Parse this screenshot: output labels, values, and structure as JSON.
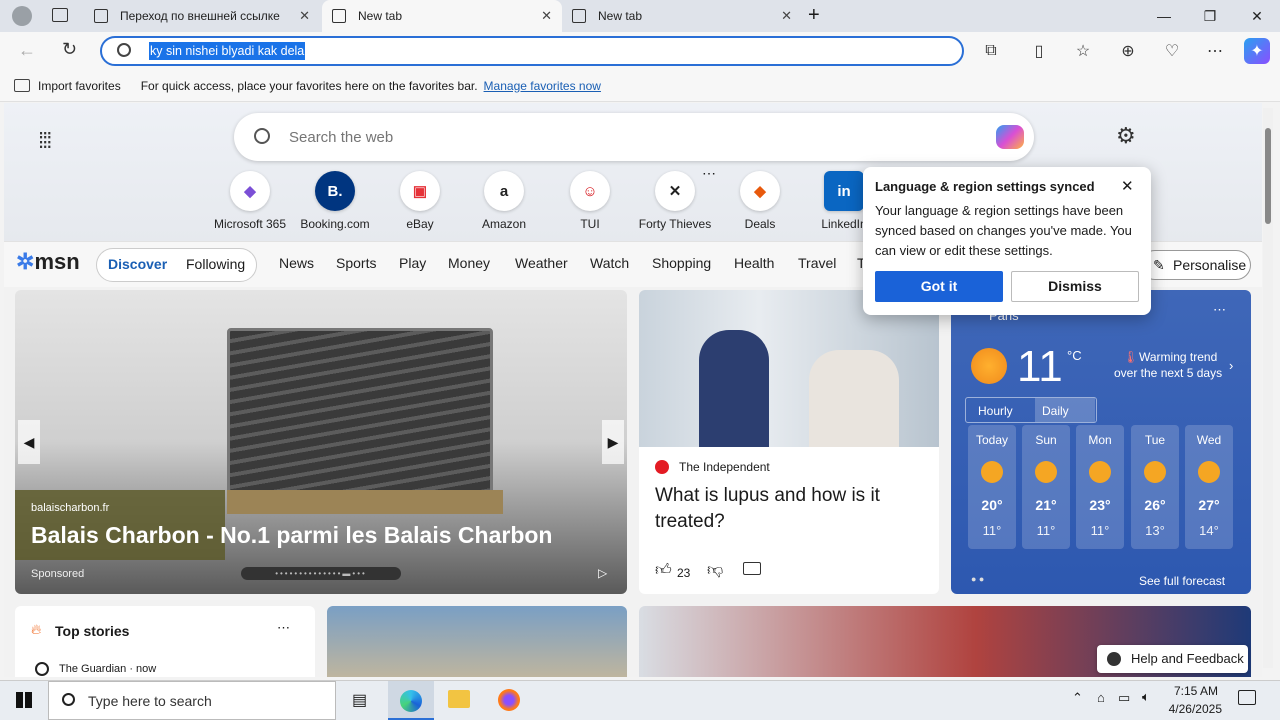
{
  "tabs": [
    {
      "label": "Переход по внешней ссылке"
    },
    {
      "label": "New tab"
    },
    {
      "label": "New tab"
    }
  ],
  "address": {
    "value": "ky sin nishei blyadi kak dela"
  },
  "favbar": {
    "import": "Import favorites",
    "hint": "For quick access, place your favorites here on the favorites bar.",
    "manage": "Manage favorites now"
  },
  "search": {
    "placeholder": "Search the web"
  },
  "quicklinks": [
    {
      "label": "Microsoft 365",
      "icon": "office-icon"
    },
    {
      "label": "Booking.com",
      "icon": "B."
    },
    {
      "label": "eBay",
      "icon": "bag"
    },
    {
      "label": "Amazon",
      "icon": "a"
    },
    {
      "label": "TUI",
      "icon": "tui"
    },
    {
      "label": "Forty Thieves",
      "icon": "swords"
    },
    {
      "label": "Deals",
      "icon": "tag"
    },
    {
      "label": "LinkedIn",
      "icon": "in"
    }
  ],
  "nav": {
    "brand": "msn",
    "discover": "Discover",
    "following": "Following",
    "items": [
      "News",
      "Sports",
      "Play",
      "Money",
      "Weather",
      "Watch",
      "Shopping",
      "Health",
      "Travel",
      "T"
    ],
    "personalise": "Personalise"
  },
  "hero": {
    "source": "balaischarbon.fr",
    "title": "Balais Charbon - No.1 parmi les Balais Charbon",
    "sponsored": "Sponsored"
  },
  "story": {
    "source": "The Independent",
    "title": "What is lupus and how is it treated?",
    "likes": "23"
  },
  "weather": {
    "location": "Paris",
    "temp": "11",
    "unit": "°C",
    "trend": "Warming trend",
    "trend2": "over the next 5 days",
    "tab_hourly": "Hourly",
    "tab_daily": "Daily",
    "days": [
      {
        "d": "Today",
        "h": "20°",
        "l": "11°"
      },
      {
        "d": "Sun",
        "h": "21°",
        "l": "11°"
      },
      {
        "d": "Mon",
        "h": "23°",
        "l": "11°"
      },
      {
        "d": "Tue",
        "h": "26°",
        "l": "13°"
      },
      {
        "d": "Wed",
        "h": "27°",
        "l": "14°"
      }
    ],
    "full": "See full forecast"
  },
  "top": {
    "title": "Top stories",
    "source": "The Guardian · now"
  },
  "dialog": {
    "title": "Language & region settings synced",
    "body": "Your language & region settings have been synced based on changes you've made. You can view or edit these settings.",
    "ok": "Got it",
    "dismiss": "Dismiss"
  },
  "help": "Help and Feedback",
  "taskbar": {
    "search": "Type here to search",
    "time": "7:15 AM",
    "date": "4/26/2025"
  }
}
